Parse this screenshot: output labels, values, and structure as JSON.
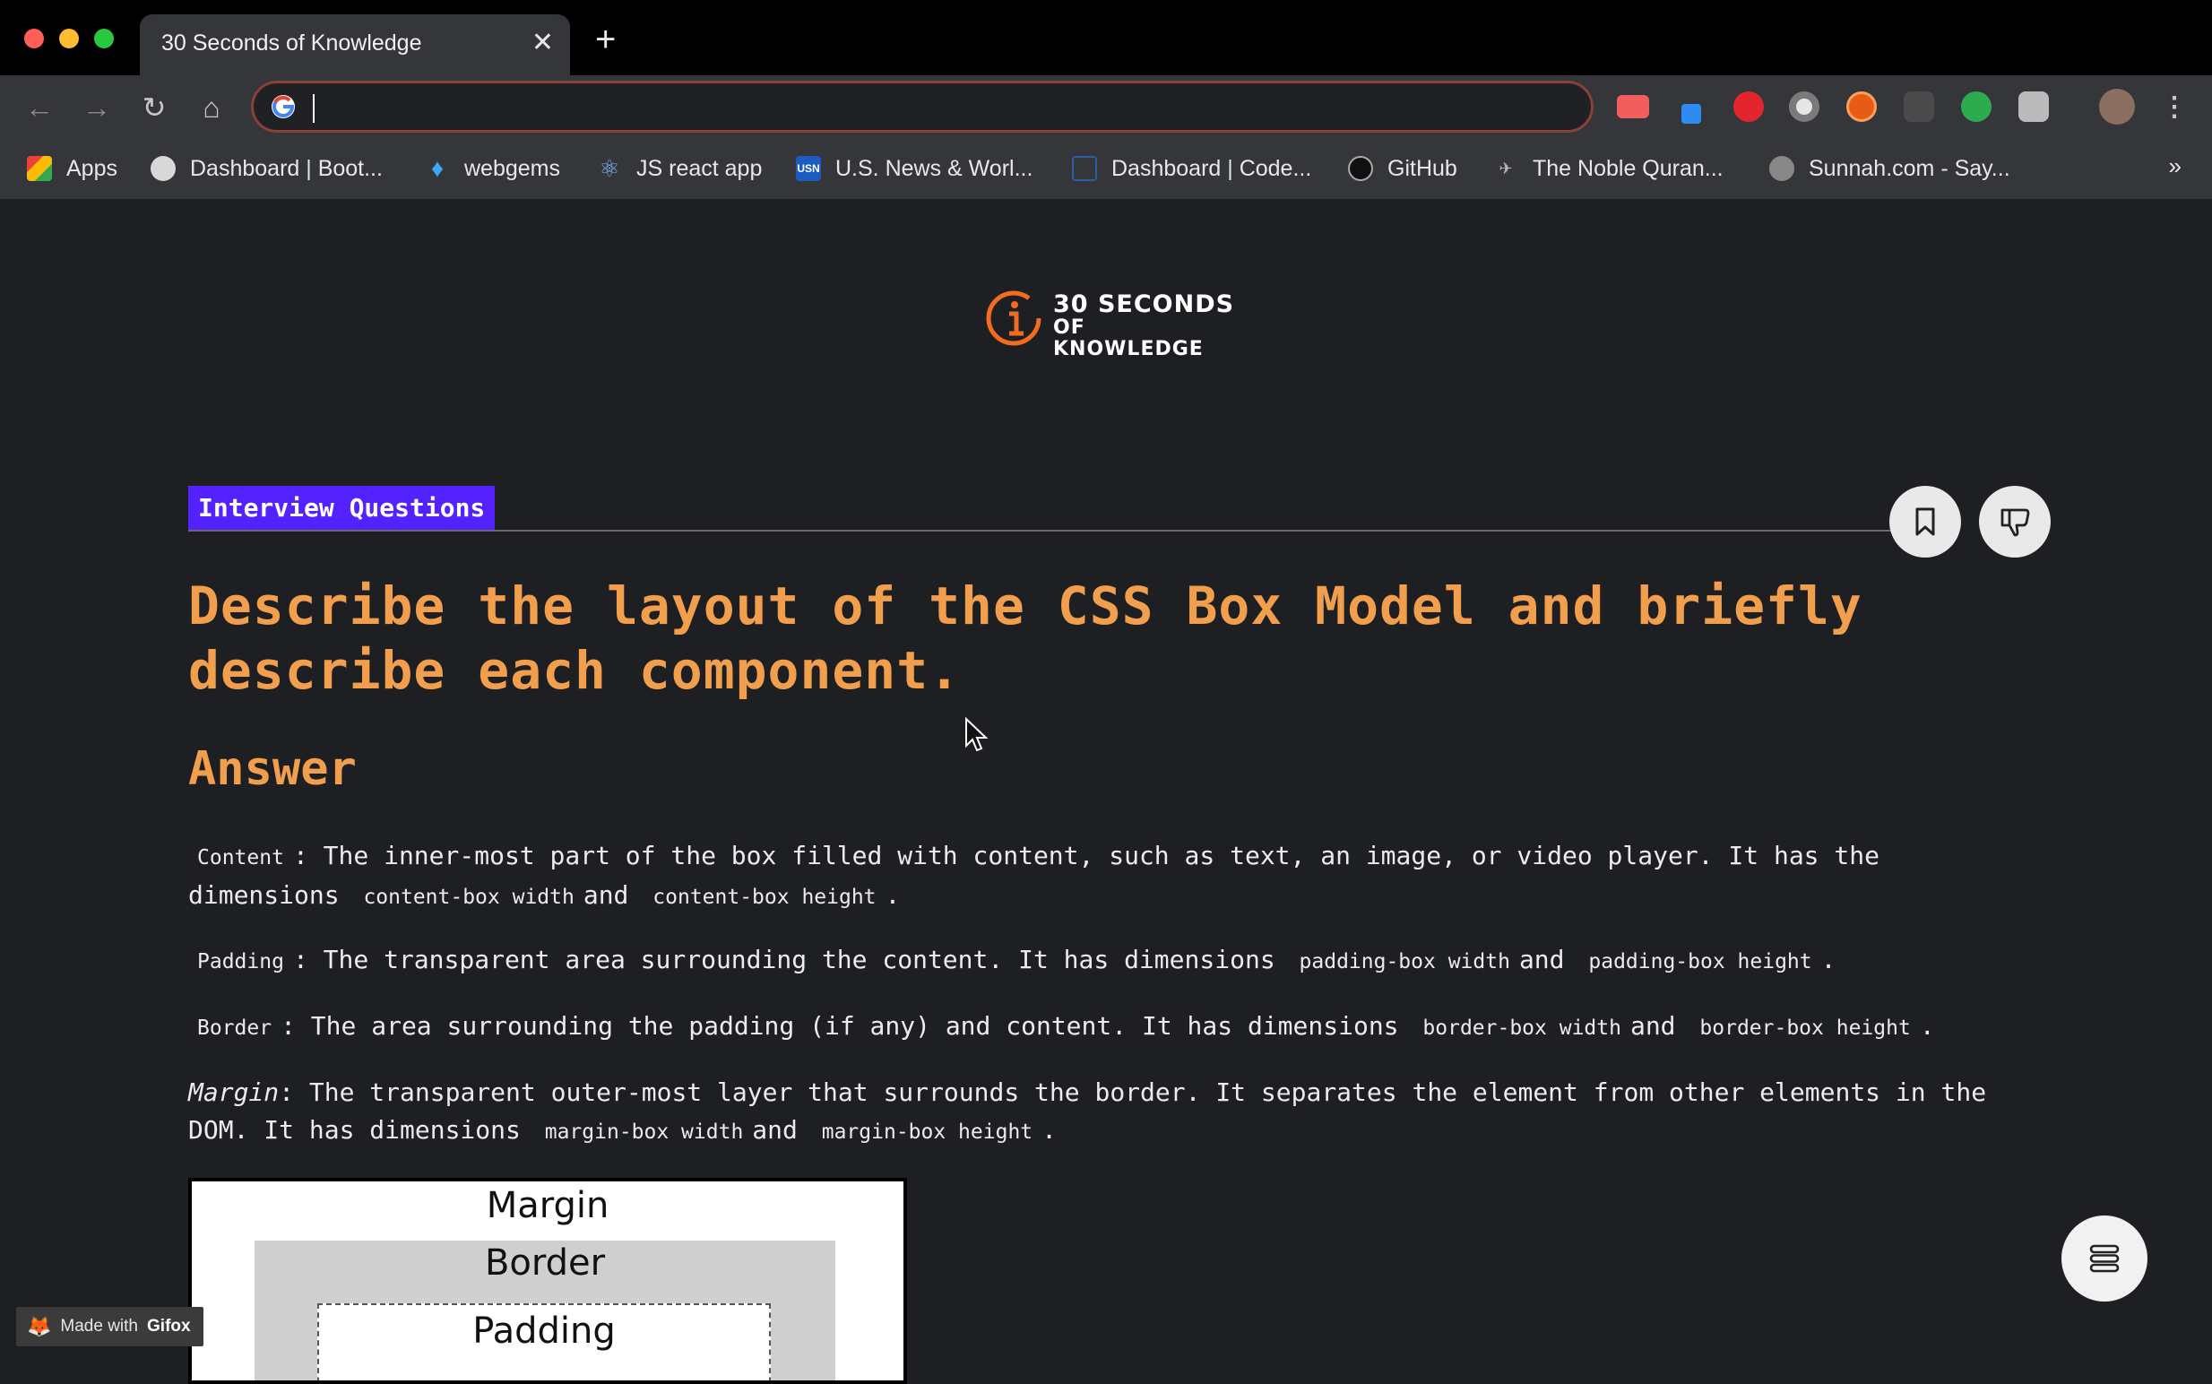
{
  "browser": {
    "tab_title": "30 Seconds of Knowledge",
    "omnibox_value": "",
    "bookmarks": [
      {
        "label": "Apps",
        "icon": "apps-grid-icon"
      },
      {
        "label": "Dashboard | Boot...",
        "icon": "globe-icon"
      },
      {
        "label": "webgems",
        "icon": "gem-icon"
      },
      {
        "label": "JS react app",
        "icon": "react-icon"
      },
      {
        "label": "U.S. News & Worl...",
        "icon": "usn-icon"
      },
      {
        "label": "Dashboard | Code...",
        "icon": "code-icon"
      },
      {
        "label": "GitHub",
        "icon": "github-icon"
      },
      {
        "label": "The Noble Quran...",
        "icon": "quran-icon"
      },
      {
        "label": "Sunnah.com - Say...",
        "icon": "sunnah-icon"
      }
    ],
    "bookmarks_overflow": "»"
  },
  "page": {
    "logo": {
      "line1": "30 SECONDS",
      "line2": "OF KNOWLEDGE",
      "accent": "#f26b21"
    },
    "tag": "Interview Questions",
    "title": "Describe the layout of the CSS Box Model and briefly describe each component.",
    "answer_heading": "Answer",
    "paragraphs": {
      "content": {
        "term": "Content",
        "text1": ": The inner-most part of the box filled with content, such as text, an image, or video player. It has the dimensions",
        "code1": "content-box width",
        "and": "and",
        "code2": "content-box height",
        "end": "."
      },
      "padding": {
        "term": "Padding",
        "text1": ": The transparent area surrounding the content. It has dimensions",
        "code1": "padding-box width",
        "and": "and",
        "code2": "padding-box height",
        "end": "."
      },
      "border": {
        "term": "Border",
        "text1": ": The area surrounding the padding (if any) and content. It has dimensions",
        "code1": "border-box width",
        "and": "and",
        "code2": "border-box height",
        "end": "."
      },
      "margin": {
        "term": "Margin",
        "text1": ": The transparent outer-most layer that surrounds the border. It separates the element from other elements in the DOM. It has dimensions",
        "code1": "margin-box width",
        "and": "and",
        "code2": "margin-box height",
        "end": "."
      }
    },
    "diagram": {
      "margin": "Margin",
      "border": "Border",
      "padding": "Padding"
    },
    "colors": {
      "accent": "#f19f4c",
      "tag_bg": "#5322ff",
      "background": "#1e1f23"
    }
  },
  "watermark": {
    "prefix": "Made with",
    "brand": "Gifox"
  }
}
